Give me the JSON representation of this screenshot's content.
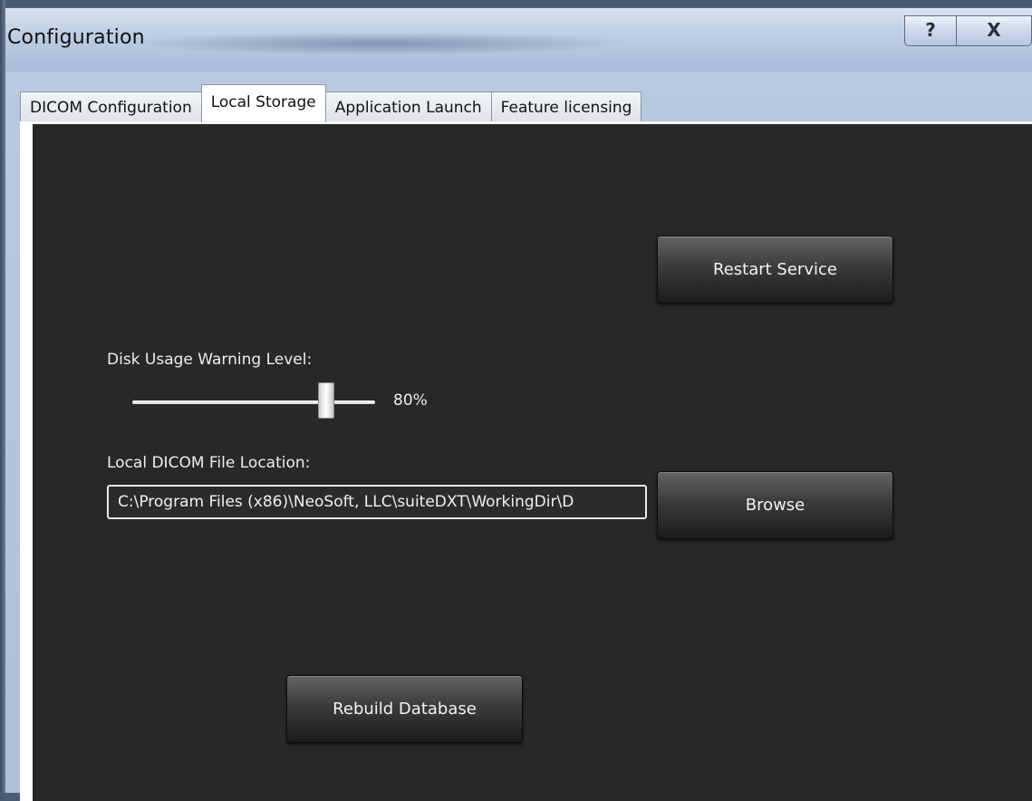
{
  "window": {
    "title": "Configuration",
    "help_label": "?",
    "close_label": "X"
  },
  "tabs": [
    {
      "label": "DICOM Configuration",
      "active": false
    },
    {
      "label": "Local Storage",
      "active": true
    },
    {
      "label": "Application Launch",
      "active": false
    },
    {
      "label": "Feature licensing",
      "active": false
    }
  ],
  "local_storage": {
    "restart_service_label": "Restart Service",
    "disk_usage_label": "Disk Usage Warning Level:",
    "disk_usage_value": "80%",
    "disk_usage_slider_level": 0.8,
    "file_location_label": "Local DICOM File Location:",
    "file_location_value": "C:\\Program Files (x86)\\NeoSoft, LLC\\suiteDXT\\WorkingDir\\D",
    "browse_label": "Browse",
    "rebuild_database_label": "Rebuild Database"
  }
}
